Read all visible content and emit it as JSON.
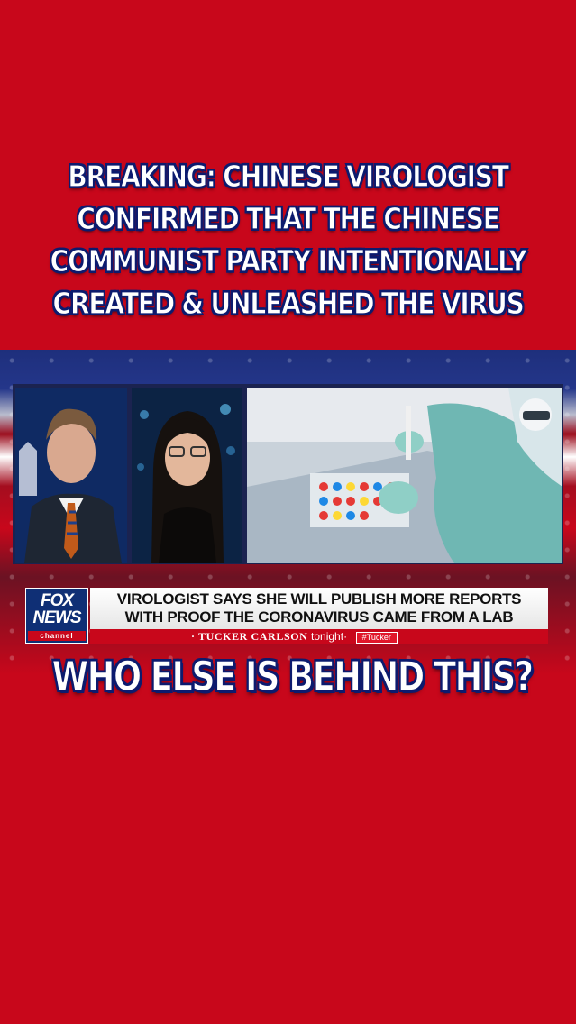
{
  "headline": {
    "lines": [
      "BREAKING: CHINESE VIROLOGIST",
      "CONFIRMED THAT THE CHINESE",
      "COMMUNIST PARTY INTENTIONALLY",
      "CREATED & UNLEASHED THE VIRUS"
    ]
  },
  "broadcast": {
    "logo": {
      "top": "FOX",
      "bottom": "NEWS",
      "channel": "channel"
    },
    "ticker": {
      "line1": "VIROLOGIST SAYS SHE WILL PUBLISH MORE REPORTS",
      "line2": "WITH PROOF THE CORONAVIRUS CAME FROM A LAB"
    },
    "show": {
      "name": "TUCKER CARLSON",
      "suffix": "tonight",
      "hashtag": "#Tucker"
    }
  },
  "question": "WHO ELSE IS BEHIND THIS?",
  "colors": {
    "background": "#c8071b",
    "text_outline": "#0d1b6e",
    "text": "#ffffff"
  }
}
